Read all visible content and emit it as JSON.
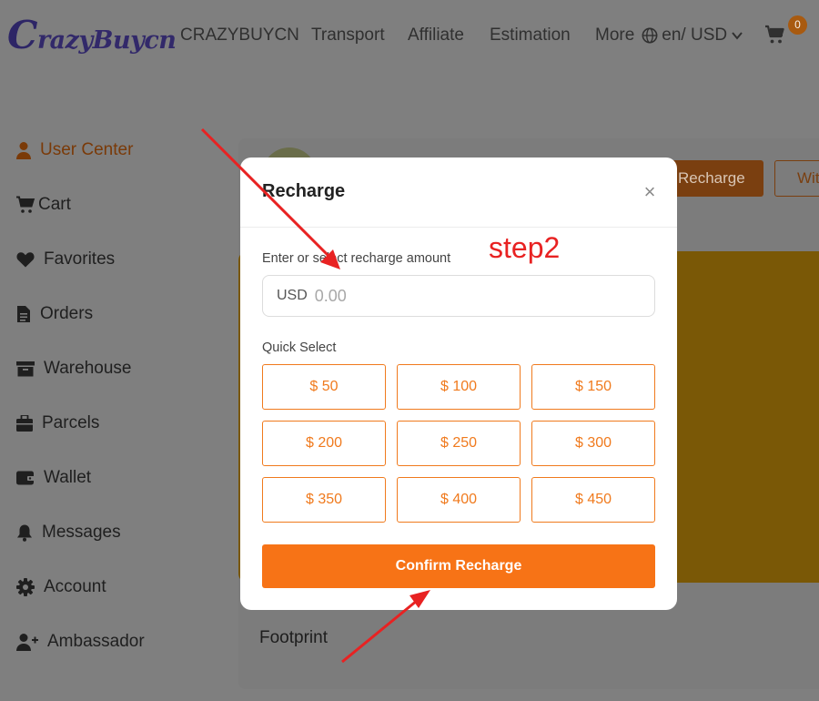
{
  "header": {
    "logo_initial": "C",
    "logo_rest": "razyBuycn",
    "nav": [
      "CRAZYBUYCN",
      "Transport",
      "Affiliate",
      "Estimation"
    ],
    "more": "More",
    "language_currency": "en/ USD",
    "cart_count": "0"
  },
  "sidebar": {
    "items": [
      {
        "label": "User Center",
        "icon": "user-icon"
      },
      {
        "label": "Cart",
        "icon": "cart-icon"
      },
      {
        "label": "Favorites",
        "icon": "heart-icon"
      },
      {
        "label": "Orders",
        "icon": "document-icon"
      },
      {
        "label": "Warehouse",
        "icon": "archive-icon"
      },
      {
        "label": "Parcels",
        "icon": "parcel-icon"
      },
      {
        "label": "Wallet",
        "icon": "wallet-icon"
      },
      {
        "label": "Messages",
        "icon": "bell-icon"
      },
      {
        "label": "Account",
        "icon": "gear-icon"
      },
      {
        "label": "Ambassador",
        "icon": "user-plus-icon"
      }
    ]
  },
  "background": {
    "recharge_button": "Recharge",
    "withdraw_button_partial": "Wit",
    "footprint": "Footprint"
  },
  "modal": {
    "title": "Recharge",
    "close": "×",
    "amount_label": "Enter or select recharge amount",
    "currency_prefix": "USD",
    "amount_placeholder": "0.00",
    "quick_select_label": "Quick Select",
    "quick_amounts": [
      "$ 50",
      "$ 100",
      "$ 150",
      "$ 200",
      "$ 250",
      "$ 300",
      "$ 350",
      "$ 400",
      "$ 450"
    ],
    "confirm_label": "Confirm Recharge"
  },
  "annotation": {
    "step_label": "step2",
    "color": "#e82222"
  },
  "colors": {
    "accent": "#f77316",
    "overlay_bg": "#7f7f7f"
  }
}
